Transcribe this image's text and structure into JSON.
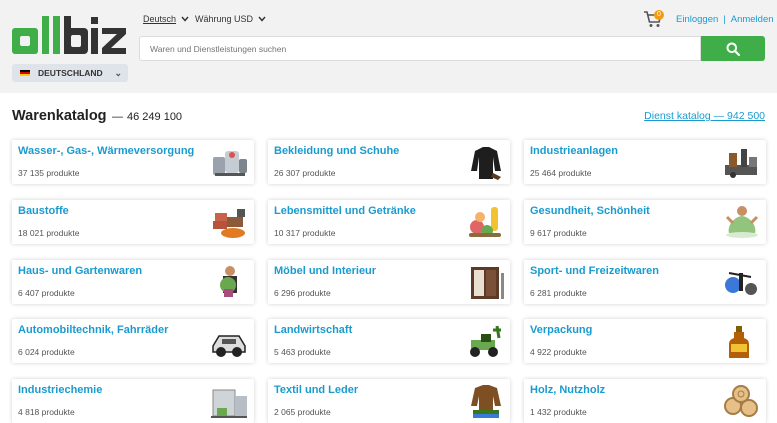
{
  "header": {
    "logo_text": "allbiz",
    "country": "DEUTSCHLAND",
    "language": "Deutsch",
    "currency": "Währung USD",
    "search_placeholder": "Waren und Dienstleistungen suchen",
    "cart_count": "0",
    "login": "Einloggen",
    "separator": "|",
    "register": "Anmelden"
  },
  "catalog": {
    "title": "Warenkatalog",
    "dash": "—",
    "count": "46 249 100",
    "service_link": "Dienst katalog — 942 500"
  },
  "categories": [
    {
      "name": "Wasser-, Gas-, Wärmeversorgung",
      "count": "37 135 produkte",
      "icon": "water-supply-icon"
    },
    {
      "name": "Bekleidung und Schuhe",
      "count": "26 307 produkte",
      "icon": "clothing-icon"
    },
    {
      "name": "Industrieanlagen",
      "count": "25 464 produkte",
      "icon": "industrial-equipment-icon"
    },
    {
      "name": "Baustoffe",
      "count": "18 021 produkte",
      "icon": "building-materials-icon"
    },
    {
      "name": "Lebensmittel und Getränke",
      "count": "10 317 produkte",
      "icon": "food-drinks-icon"
    },
    {
      "name": "Gesundheit, Schönheit",
      "count": "9 617 produkte",
      "icon": "health-beauty-icon"
    },
    {
      "name": "Haus- und Gartenwaren",
      "count": "6 407 produkte",
      "icon": "home-garden-icon"
    },
    {
      "name": "Möbel und Interieur",
      "count": "6 296 produkte",
      "icon": "furniture-icon"
    },
    {
      "name": "Sport- und Freizeitwaren",
      "count": "6 281 produkte",
      "icon": "sports-icon"
    },
    {
      "name": "Automobiltechnik, Fahrräder",
      "count": "6 024 produkte",
      "icon": "automotive-icon"
    },
    {
      "name": "Landwirtschaft",
      "count": "5 463 produkte",
      "icon": "agriculture-icon"
    },
    {
      "name": "Verpackung",
      "count": "4 922 produkte",
      "icon": "packaging-icon"
    },
    {
      "name": "Industriechemie",
      "count": "4 818 produkte",
      "icon": "chemistry-icon"
    },
    {
      "name": "Textil und Leder",
      "count": "2 065 produkte",
      "icon": "textile-leather-icon"
    },
    {
      "name": "Holz, Nutzholz",
      "count": "1 432 produkte",
      "icon": "wood-icon"
    }
  ],
  "colors": {
    "accent": "#1a9bd0",
    "search_button": "#3fae49",
    "badge": "#f39c12"
  }
}
